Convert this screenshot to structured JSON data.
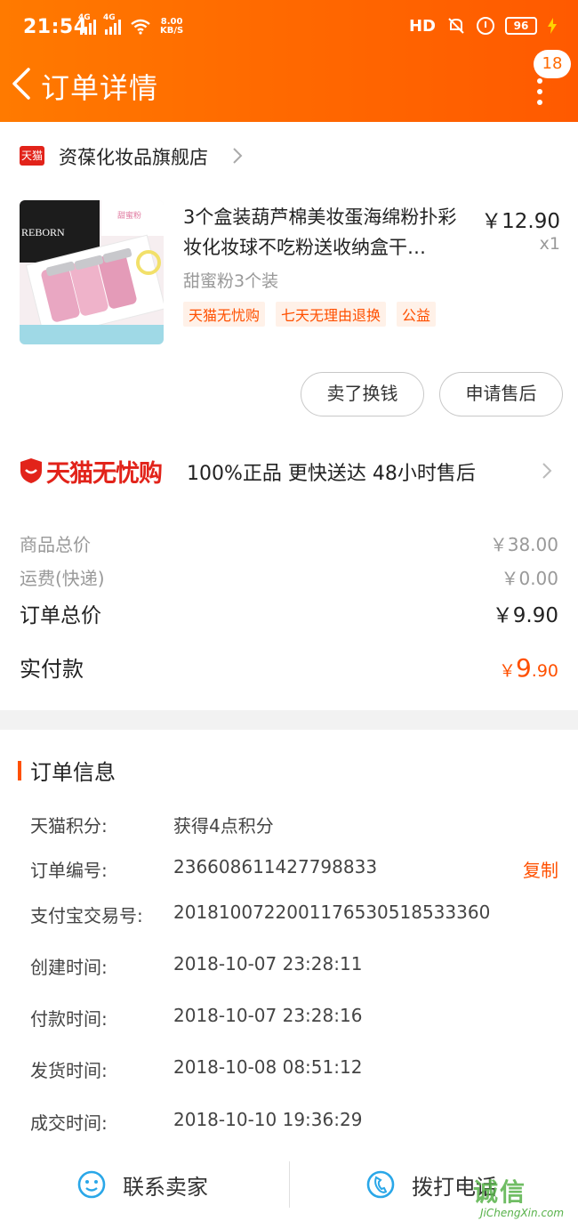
{
  "status_bar": {
    "time": "21:54",
    "net1": "4G",
    "net2": "4G",
    "speed_value": "8.00",
    "speed_unit": "KB/S",
    "hd": "HD",
    "battery": "96"
  },
  "header": {
    "title": "订单详情",
    "badge_count": "18",
    "bg_color": "#ff6a00"
  },
  "shop": {
    "platform_badge": "天猫",
    "name": "资葆化妆品旗舰店"
  },
  "product": {
    "title": "3个盒装葫芦棉美妆蛋海绵粉扑彩妆化妆球不吃粉送收纳盒干…",
    "price": "￥12.90",
    "quantity": "x1",
    "sku": "甜蜜粉3个装",
    "tags": [
      "天猫无忧购",
      "七天无理由退换",
      "公益"
    ],
    "thumb_brand": "REBORN",
    "thumb_label": "甜蜜粉"
  },
  "actions": {
    "sell_label": "卖了换钱",
    "after_sale_label": "申请售后"
  },
  "guarantee": {
    "brand": "天猫无忧购",
    "text": "100%正品  更快送达  48小时售后"
  },
  "summary": {
    "goods_total_label": "商品总价",
    "goods_total_value": "￥38.00",
    "shipping_label": "运费(快递)",
    "shipping_value": "￥0.00",
    "order_total_label": "订单总价",
    "order_total_value": "￥9.90",
    "paid_label": "实付款",
    "paid_currency": "￥",
    "paid_integer": "9",
    "paid_decimal": ".90",
    "accent_color": "#ff5000"
  },
  "order_info": {
    "title": "订单信息",
    "rows": [
      {
        "label": "天猫积分:",
        "value": "获得4点积分"
      },
      {
        "label": "订单编号:",
        "value": "236608611427798833"
      },
      {
        "label": "支付宝交易号:",
        "value": "2018100722001176530518533360"
      },
      {
        "label": "创建时间:",
        "value": "2018-10-07 23:28:11"
      },
      {
        "label": "付款时间:",
        "value": "2018-10-07 23:28:16"
      },
      {
        "label": "发货时间:",
        "value": "2018-10-08 08:51:12"
      },
      {
        "label": "成交时间:",
        "value": "2018-10-10 19:36:29"
      }
    ],
    "copy_label": "复制"
  },
  "bottom_bar": {
    "contact_label": "联系卖家",
    "call_label": "拨打电话"
  },
  "watermark": {
    "text": "诚信",
    "sub": "JiChengXin.com"
  }
}
